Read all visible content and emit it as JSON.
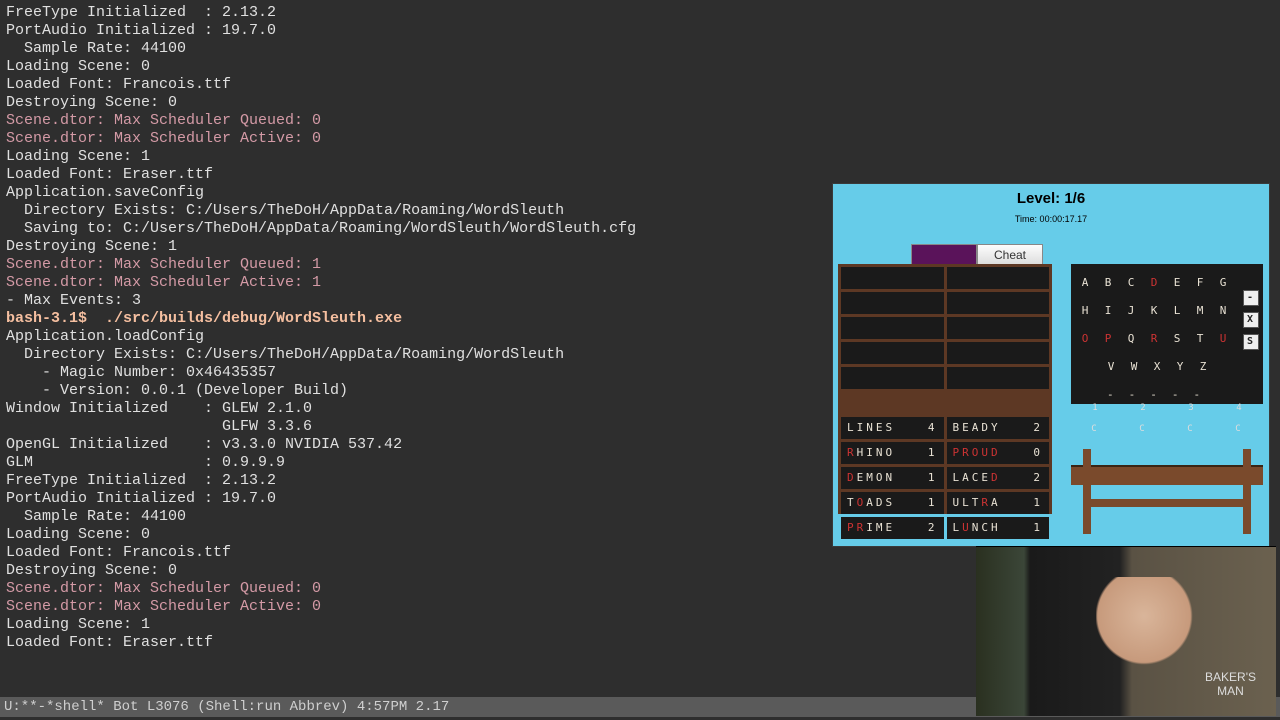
{
  "terminal": {
    "lines": [
      {
        "cls": "t-normal",
        "text": "FreeType Initialized  : 2.13.2"
      },
      {
        "cls": "t-normal",
        "text": "PortAudio Initialized : 19.7.0"
      },
      {
        "cls": "t-normal",
        "text": "  Sample Rate: 44100"
      },
      {
        "cls": "t-normal",
        "text": "Loading Scene: 0"
      },
      {
        "cls": "t-normal",
        "text": "Loaded Font: Francois.ttf"
      },
      {
        "cls": "t-normal",
        "text": "Destroying Scene: 0"
      },
      {
        "cls": "t-pink",
        "text": "Scene.dtor: Max Scheduler Queued: 0"
      },
      {
        "cls": "t-pink",
        "text": "Scene.dtor: Max Scheduler Active: 0"
      },
      {
        "cls": "t-normal",
        "text": "Loading Scene: 1"
      },
      {
        "cls": "t-normal",
        "text": "Loaded Font: Eraser.ttf"
      },
      {
        "cls": "t-normal",
        "text": "Application.saveConfig"
      },
      {
        "cls": "t-normal",
        "text": "  Directory Exists: C:/Users/TheDoH/AppData/Roaming/WordSleuth"
      },
      {
        "cls": "t-normal",
        "text": "  Saving to: C:/Users/TheDoH/AppData/Roaming/WordSleuth/WordSleuth.cfg"
      },
      {
        "cls": "t-normal",
        "text": "Destroying Scene: 1"
      },
      {
        "cls": "t-pink",
        "text": "Scene.dtor: Max Scheduler Queued: 1"
      },
      {
        "cls": "t-pink",
        "text": "Scene.dtor: Max Scheduler Active: 1"
      },
      {
        "cls": "t-normal",
        "text": "- Max Events: 3"
      },
      {
        "cls": "t-bold",
        "text": "bash-3.1$  ./src/builds/debug/WordSleuth.exe"
      },
      {
        "cls": "t-normal",
        "text": "Application.loadConfig"
      },
      {
        "cls": "t-normal",
        "text": "  Directory Exists: C:/Users/TheDoH/AppData/Roaming/WordSleuth"
      },
      {
        "cls": "t-normal",
        "text": "    - Magic Number: 0x46435357"
      },
      {
        "cls": "t-normal",
        "text": "    - Version: 0.0.1 (Developer Build)"
      },
      {
        "cls": "t-normal",
        "text": "Window Initialized    : GLEW 2.1.0"
      },
      {
        "cls": "t-normal",
        "text": "                        GLFW 3.3.6"
      },
      {
        "cls": "t-normal",
        "text": "OpenGL Initialized    : v3.3.0 NVIDIA 537.42"
      },
      {
        "cls": "t-normal",
        "text": "GLM                   : 0.9.9.9"
      },
      {
        "cls": "t-normal",
        "text": "FreeType Initialized  : 2.13.2"
      },
      {
        "cls": "t-normal",
        "text": "PortAudio Initialized : 19.7.0"
      },
      {
        "cls": "t-normal",
        "text": "  Sample Rate: 44100"
      },
      {
        "cls": "t-normal",
        "text": "Loading Scene: 0"
      },
      {
        "cls": "t-normal",
        "text": "Loaded Font: Francois.ttf"
      },
      {
        "cls": "t-normal",
        "text": "Destroying Scene: 0"
      },
      {
        "cls": "t-pink",
        "text": "Scene.dtor: Max Scheduler Queued: 0"
      },
      {
        "cls": "t-pink",
        "text": "Scene.dtor: Max Scheduler Active: 0"
      },
      {
        "cls": "t-normal",
        "text": "Loading Scene: 1"
      },
      {
        "cls": "t-normal",
        "text": "Loaded Font: Eraser.ttf"
      }
    ]
  },
  "statusbar": "U:**-*shell*      Bot L3076  (Shell:run Abbrev) 4:57PM 2.17",
  "game": {
    "level": "Level: 1/6",
    "time": "Time: 00:00:17.17",
    "cheat": "Cheat",
    "guesses": [
      {
        "word": "LINES",
        "num": "4",
        "hl": []
      },
      {
        "word": "BEADY",
        "num": "2",
        "hl": []
      },
      {
        "word": "RHINO",
        "num": "1",
        "hl": [
          0
        ]
      },
      {
        "word": "PROUD",
        "num": "0",
        "hl": [
          0,
          1,
          2,
          3,
          4
        ]
      },
      {
        "word": "DEMON",
        "num": "1",
        "hl": [
          0
        ]
      },
      {
        "word": "LACED",
        "num": "2",
        "hl": [
          4
        ]
      },
      {
        "word": "TOADS",
        "num": "1",
        "hl": [
          1
        ]
      },
      {
        "word": "ULTRA",
        "num": "1",
        "hl": [
          3
        ]
      },
      {
        "word": "PRIME",
        "num": "2",
        "hl": [
          0,
          1
        ]
      },
      {
        "word": "LUNCH",
        "num": "1",
        "hl": [
          1
        ]
      }
    ],
    "alphabet": [
      [
        "A",
        "B",
        "C",
        "D",
        "E",
        "F",
        "G"
      ],
      [
        "H",
        "I",
        "J",
        "K",
        "L",
        "M",
        "N"
      ],
      [
        "O",
        "P",
        "Q",
        "R",
        "S",
        "T",
        "U"
      ],
      [
        "V",
        "W",
        "X",
        "Y",
        "Z"
      ]
    ],
    "alphabet_red": [
      "D",
      "O",
      "P",
      "R",
      "U"
    ],
    "side_buttons": [
      "-",
      "X",
      "S"
    ],
    "desk_labels_top": [
      "1",
      "2",
      "3",
      "4"
    ],
    "desk_labels_bot": [
      "C",
      "C",
      "C",
      "C"
    ],
    "desk_first_c_color": "cyan"
  },
  "webcam": {
    "shirt": "BAKER'S\nMAN"
  }
}
